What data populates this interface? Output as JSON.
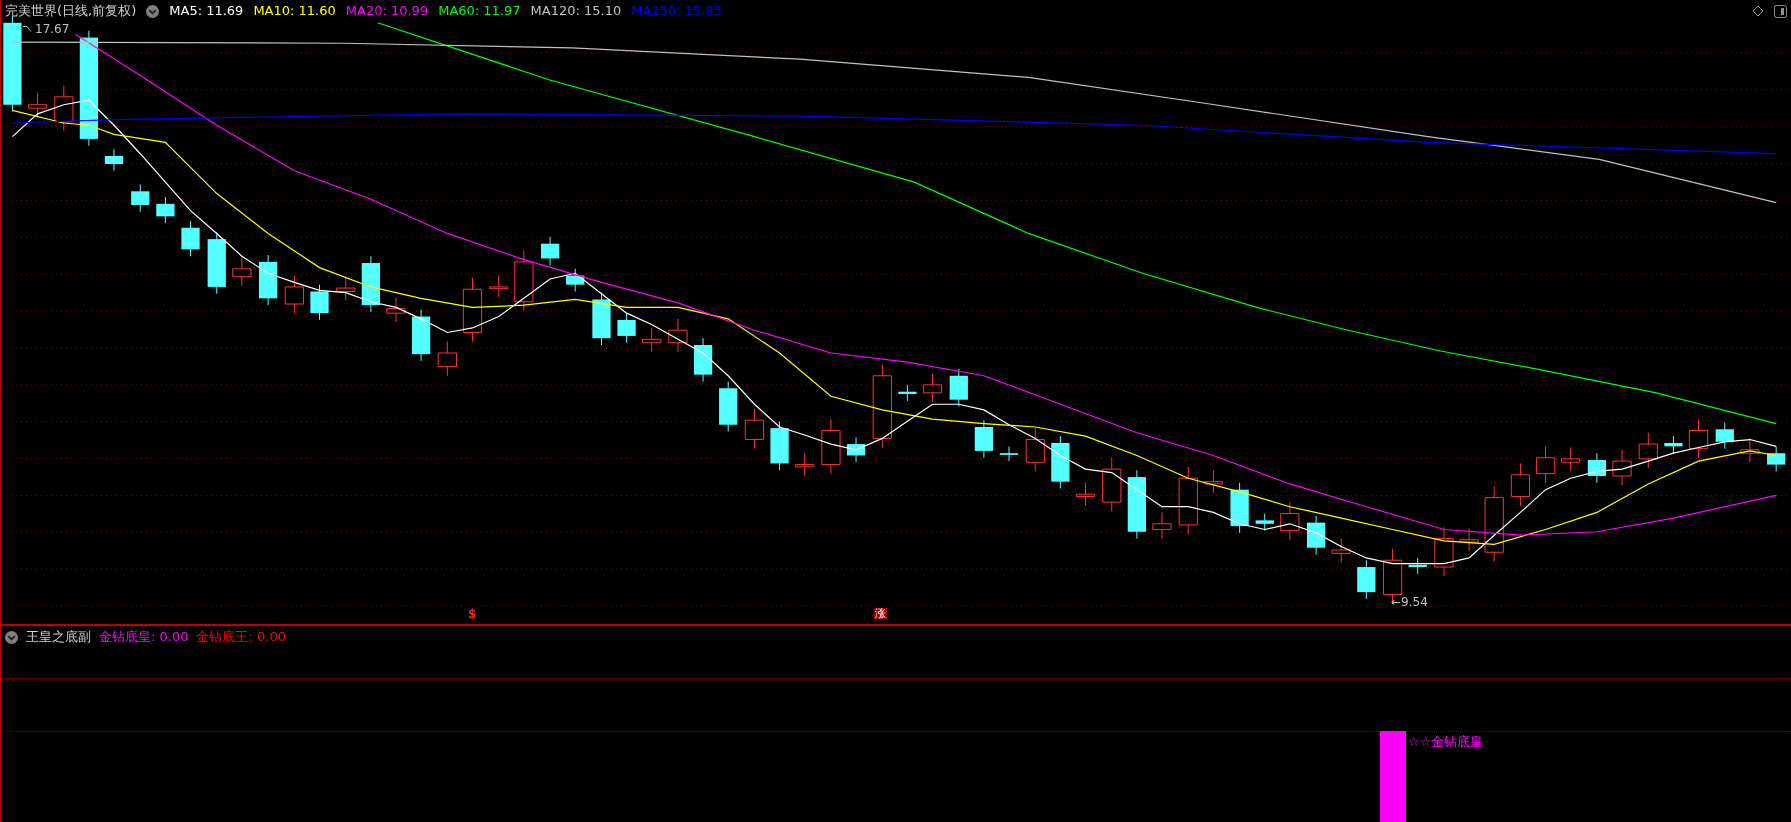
{
  "header": {
    "title": "完美世界(日线,前复权)",
    "averages": [
      {
        "text": "MA5: 11.69",
        "color": "#ffffff"
      },
      {
        "text": "MA10: 11.60",
        "color": "#ffff00"
      },
      {
        "text": "MA20: 10.99",
        "color": "#ff00ff"
      },
      {
        "text": "MA60: 11.97",
        "color": "#00ff00"
      },
      {
        "text": "MA120: 15.10",
        "color": "#c0c0c0"
      },
      {
        "text": "MA250: 15.83",
        "color": "#0000ff"
      }
    ]
  },
  "annotations": {
    "high": "17.67",
    "low": "←9.54"
  },
  "markers": [
    {
      "kind": "dollar",
      "text": "$"
    },
    {
      "kind": "boxed",
      "text": "涨"
    }
  ],
  "indicator": {
    "title": "王皇之底副",
    "lines": [
      {
        "text": "金钻底皇: 0.00",
        "color": "#ff00ff"
      },
      {
        "text": "金钻底王: 0.00",
        "color": "#ff0000"
      }
    ],
    "signal_label": "☆☆金钻底皇"
  }
}
